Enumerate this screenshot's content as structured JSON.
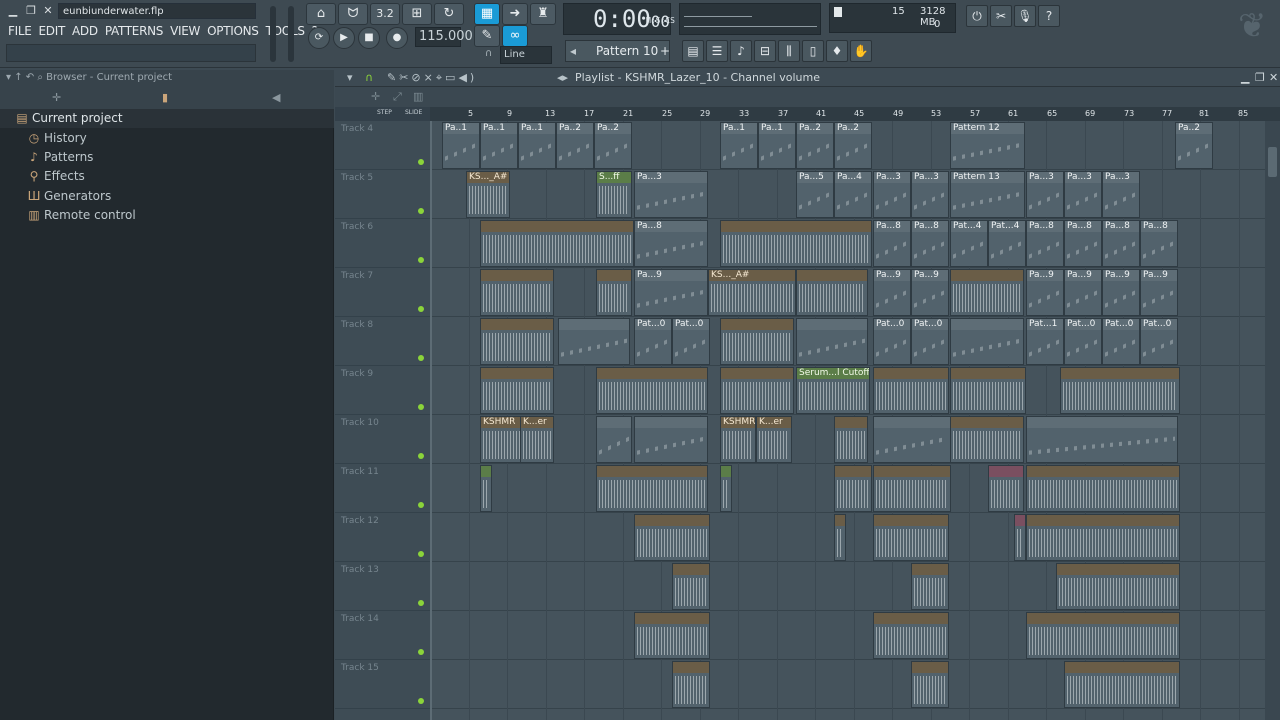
{
  "window": {
    "filename": "eunbiunderwater.flp"
  },
  "menu": [
    "FILE",
    "EDIT",
    "ADD",
    "PATTERNS",
    "VIEW",
    "OPTIONS",
    "TOOLS",
    "?"
  ],
  "transport": {
    "tempo": "115.000",
    "time": "0:00",
    "time_sub": "00",
    "time_unit": "M:S:CS",
    "snap": "Line"
  },
  "pattern_selector": {
    "label": "Pattern 10",
    "plus": "+"
  },
  "cpu": {
    "cpu_value": "15",
    "memory": "3128 MB",
    "polyphony": "0"
  },
  "browser": {
    "header": "Browser - Current project",
    "root": "Current project",
    "items": [
      "History",
      "Patterns",
      "Effects",
      "Generators",
      "Remote control"
    ]
  },
  "playlist": {
    "title": "Playlist - KSHMR_Lazer_10 - Channel volume",
    "step_label": "STEP",
    "slide_label": "SLIDE",
    "ruler": [
      "5",
      "9",
      "13",
      "17",
      "21",
      "25",
      "29",
      "33",
      "37",
      "41",
      "45",
      "49",
      "53",
      "57",
      "61",
      "65",
      "69",
      "73",
      "77",
      "81",
      "85"
    ],
    "tracks": [
      "Track 4",
      "Track 5",
      "Track 6",
      "Track 7",
      "Track 8",
      "Track 9",
      "Track 10",
      "Track 11",
      "Track 12",
      "Track 13",
      "Track 14",
      "Track 15"
    ],
    "clip_labels": {
      "pa1": "Pa..1",
      "pa2": "Pa..2",
      "pattern12": "Pattern 12",
      "ks_a": "KS..._A#",
      "sff": "S...ff",
      "pa3": "Pa...3",
      "pa5": "Pa...5",
      "pa4": "Pa...4",
      "pattern13": "Pattern 13",
      "pa8": "Pa...8",
      "pat4": "Pat...4",
      "pa9": "Pa...9",
      "pat0": "Pat...0",
      "pat1": "Pat...1",
      "serum": "Serum...l Cutoff",
      "kshmr_k": "KSHMR",
      "ker": "K...er"
    }
  }
}
